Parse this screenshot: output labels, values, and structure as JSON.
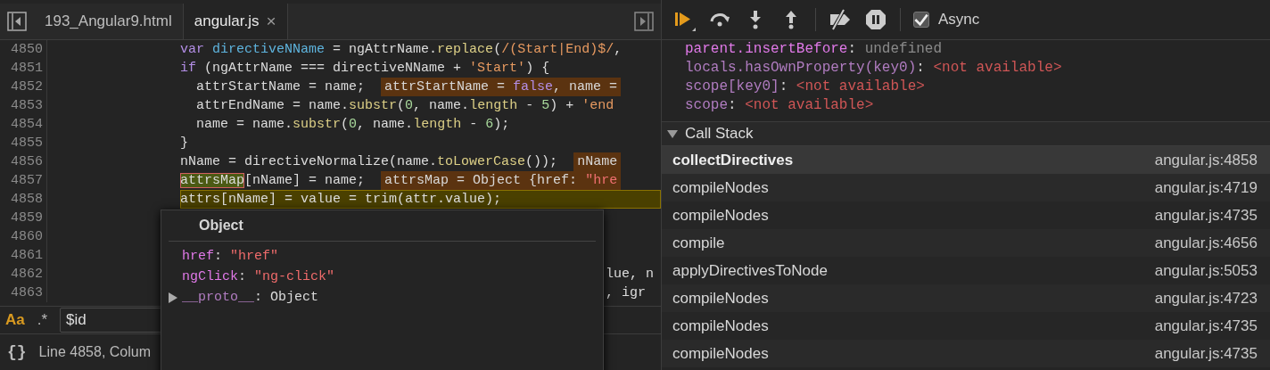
{
  "editor": {
    "tabs": [
      {
        "label": "193_Angular9.html",
        "selected": false
      },
      {
        "label": "angular.js",
        "selected": true,
        "close": "×"
      }
    ],
    "lines": [
      {
        "number": "4850",
        "current": false,
        "segments": [
          {
            "kind": "keyword",
            "text": "                var"
          },
          {
            "kind": "variable",
            "text": " directiveNName"
          },
          {
            "kind": "plain",
            "text": " = ngAttrName."
          },
          {
            "kind": "method",
            "text": "replace"
          },
          {
            "kind": "plain",
            "text": "("
          },
          {
            "kind": "regex",
            "text": "/(Start|End)$/"
          },
          {
            "kind": "plain",
            "text": ","
          }
        ]
      },
      {
        "number": "4851",
        "current": false,
        "segments": [
          {
            "kind": "keyword",
            "text": "                if"
          },
          {
            "kind": "plain",
            "text": " (ngAttrName === directiveNName + "
          },
          {
            "kind": "string",
            "text": "'Start'"
          },
          {
            "kind": "plain",
            "text": ") {"
          }
        ]
      },
      {
        "number": "4852",
        "current": false,
        "segments": [
          {
            "kind": "plain",
            "text": "                  attrStartName = name;"
          }
        ],
        "inline": [
          {
            "kind": "plain",
            "text": "attrStartName = "
          },
          {
            "kind": "keyword",
            "text": "false"
          },
          {
            "kind": "plain",
            "text": ", name ="
          }
        ]
      },
      {
        "number": "4853",
        "current": false,
        "segments": [
          {
            "kind": "plain",
            "text": "                  attrEndName = name."
          },
          {
            "kind": "method",
            "text": "substr"
          },
          {
            "kind": "plain",
            "text": "("
          },
          {
            "kind": "number",
            "text": "0"
          },
          {
            "kind": "plain",
            "text": ", name."
          },
          {
            "kind": "method",
            "text": "length"
          },
          {
            "kind": "plain",
            "text": " - "
          },
          {
            "kind": "number",
            "text": "5"
          },
          {
            "kind": "plain",
            "text": ") + "
          },
          {
            "kind": "string",
            "text": "'end"
          }
        ]
      },
      {
        "number": "4854",
        "current": false,
        "segments": [
          {
            "kind": "plain",
            "text": "                  name = name."
          },
          {
            "kind": "method",
            "text": "substr"
          },
          {
            "kind": "plain",
            "text": "("
          },
          {
            "kind": "number",
            "text": "0"
          },
          {
            "kind": "plain",
            "text": ", name."
          },
          {
            "kind": "method",
            "text": "length"
          },
          {
            "kind": "plain",
            "text": " - "
          },
          {
            "kind": "number",
            "text": "6"
          },
          {
            "kind": "plain",
            "text": ");"
          }
        ]
      },
      {
        "number": "4855",
        "current": false,
        "segments": [
          {
            "kind": "plain",
            "text": "                }"
          }
        ]
      },
      {
        "number": "4856",
        "current": false,
        "segments": [
          {
            "kind": "plain",
            "text": "                nName = directiveNormalize(name."
          },
          {
            "kind": "method",
            "text": "toLowerCase"
          },
          {
            "kind": "plain",
            "text": "());"
          }
        ],
        "inline": [
          {
            "kind": "plain",
            "text": "nName"
          }
        ]
      },
      {
        "number": "4857",
        "current": false,
        "segments": [
          {
            "kind": "highlight",
            "text": "                attrsMap"
          },
          {
            "kind": "plain",
            "text": "[nName] = name;"
          }
        ],
        "inline": [
          {
            "kind": "plain",
            "text": "attrsMap = Object {href: "
          },
          {
            "kind": "string",
            "text": "\"hre"
          }
        ]
      },
      {
        "number": "4858",
        "current": true,
        "segments": [
          {
            "kind": "plain",
            "text": "                attrs[nName] = value = trim(attr.value);"
          }
        ]
      },
      {
        "number": "4859",
        "current": false
      },
      {
        "number": "4860",
        "current": false
      },
      {
        "number": "4861",
        "current": false
      },
      {
        "number": "4862",
        "current": false,
        "segments": [
          {
            "kind": "plain",
            "text": "                                                                     lue, n"
          }
        ]
      },
      {
        "number": "4863",
        "current": false,
        "segments": [
          {
            "kind": "plain",
            "text": "                                                                     , igr"
          }
        ]
      }
    ],
    "search": {
      "match_case": {
        "label": "Aa",
        "on": true
      },
      "regex": {
        "label": ".*",
        "on": false
      },
      "value": "$id"
    },
    "status_bar": {
      "format_label": "{}",
      "position": "Line 4858, Colum"
    }
  },
  "popover": {
    "title": "Object",
    "properties": [
      {
        "name": "href",
        "separator": ":",
        "value": "\"href\"",
        "kind": "string"
      },
      {
        "name": "ngClick",
        "separator": ":",
        "value": "\"ng-click\"",
        "kind": "string"
      },
      {
        "name": "__proto__",
        "separator": ":",
        "value": "Object",
        "kind": "object",
        "expandable": true
      }
    ]
  },
  "debugger": {
    "async": {
      "label": "Async",
      "checked": true
    },
    "scope": [
      {
        "name": "parent.insertBefore",
        "separator": ":",
        "value": "undefined",
        "kind": "undefined",
        "dimmed": false
      },
      {
        "name": "locals.hasOwnProperty(key0)",
        "separator": ":",
        "value": "<not available>",
        "kind": "unavailable",
        "dimmed": true
      },
      {
        "name": "scope[key0]",
        "separator": ":",
        "value": "<not available>",
        "kind": "unavailable",
        "dimmed": true
      },
      {
        "name": "scope",
        "separator": ":",
        "value": "<not available>",
        "kind": "unavailable",
        "dimmed": true
      }
    ],
    "call_stack": {
      "title": "Call Stack",
      "expanded": true,
      "frames": [
        {
          "function": "collectDirectives",
          "location": "angular.js:4858",
          "selected": true
        },
        {
          "function": "compileNodes",
          "location": "angular.js:4719",
          "selected": false
        },
        {
          "function": "compileNodes",
          "location": "angular.js:4735",
          "selected": false
        },
        {
          "function": "compile",
          "location": "angular.js:4656",
          "selected": false
        },
        {
          "function": "applyDirectivesToNode",
          "location": "angular.js:5053",
          "selected": false
        },
        {
          "function": "compileNodes",
          "location": "angular.js:4723",
          "selected": false
        },
        {
          "function": "compileNodes",
          "location": "angular.js:4735",
          "selected": false
        },
        {
          "function": "compileNodes",
          "location": "angular.js:4735",
          "selected": false
        }
      ]
    }
  }
}
